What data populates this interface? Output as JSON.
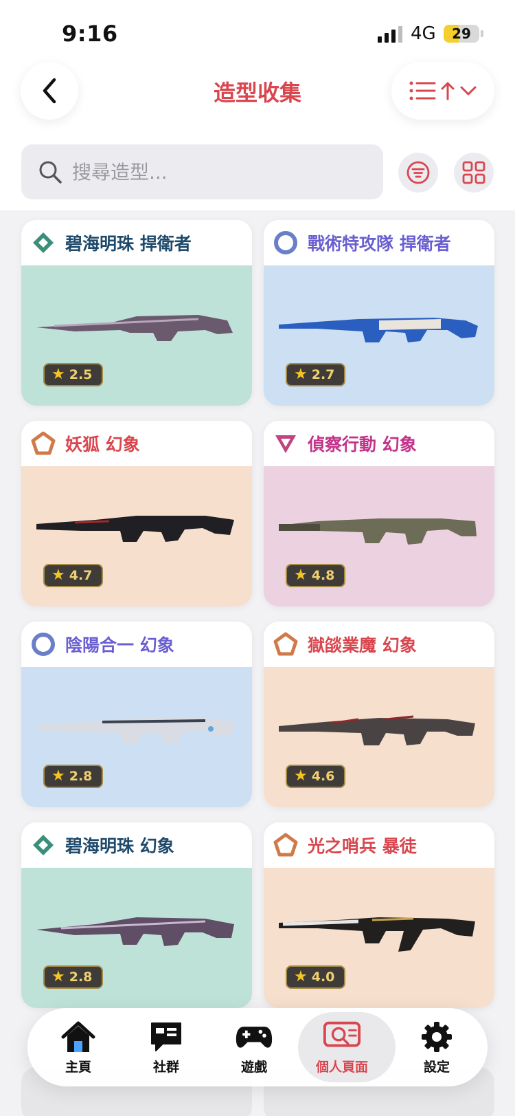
{
  "status_bar": {
    "time": "9:16",
    "network": "4G",
    "battery": "29"
  },
  "header": {
    "title": "造型收集"
  },
  "search": {
    "placeholder": "搜尋造型..."
  },
  "colors": {
    "accent": "#d9464e",
    "tiers": {
      "deluxe": "#3a8f7a",
      "select": "#6a7fc8",
      "exclusive": "#d07a4a",
      "premium": "#c2447e"
    },
    "card_bg": {
      "deluxe": "#bfe2d8",
      "select": "#cddff2",
      "exclusive": "#f6dfcd",
      "premium": "#ecd1e0"
    },
    "name": {
      "deluxe": "#1f4a6b",
      "select": "#6a5fd0",
      "exclusive": "#d9464e",
      "premium": "#c2338a"
    }
  },
  "skins": [
    {
      "name": "碧海明珠 捍衛者",
      "tier": "deluxe",
      "tier_icon": "diamond-tier-icon",
      "rating": "2.5"
    },
    {
      "name": "戰術特攻隊 捍衛者",
      "tier": "select",
      "tier_icon": "circle-tier-icon",
      "rating": "2.7"
    },
    {
      "name": "妖狐 幻象",
      "tier": "exclusive",
      "tier_icon": "pentagon-tier-icon",
      "rating": "4.7"
    },
    {
      "name": "偵察行動 幻象",
      "tier": "premium",
      "tier_icon": "triangle-tier-icon",
      "rating": "4.8"
    },
    {
      "name": "陰陽合一 幻象",
      "tier": "select",
      "tier_icon": "circle-tier-icon",
      "rating": "2.8"
    },
    {
      "name": "獄燄業魔 幻象",
      "tier": "exclusive",
      "tier_icon": "pentagon-tier-icon",
      "rating": "4.6"
    },
    {
      "name": "碧海明珠 幻象",
      "tier": "deluxe",
      "tier_icon": "diamond-tier-icon",
      "rating": "2.8"
    },
    {
      "name": "光之哨兵 暴徒",
      "tier": "exclusive",
      "tier_icon": "pentagon-tier-icon",
      "rating": "4.0"
    }
  ],
  "nav": [
    {
      "label": "主頁",
      "icon": "home-icon",
      "active": false
    },
    {
      "label": "社群",
      "icon": "chat-icon",
      "active": false
    },
    {
      "label": "遊戲",
      "icon": "gamepad-icon",
      "active": false
    },
    {
      "label": "個人頁面",
      "icon": "profile-search-icon",
      "active": true
    },
    {
      "label": "設定",
      "icon": "gear-icon",
      "active": false
    }
  ]
}
